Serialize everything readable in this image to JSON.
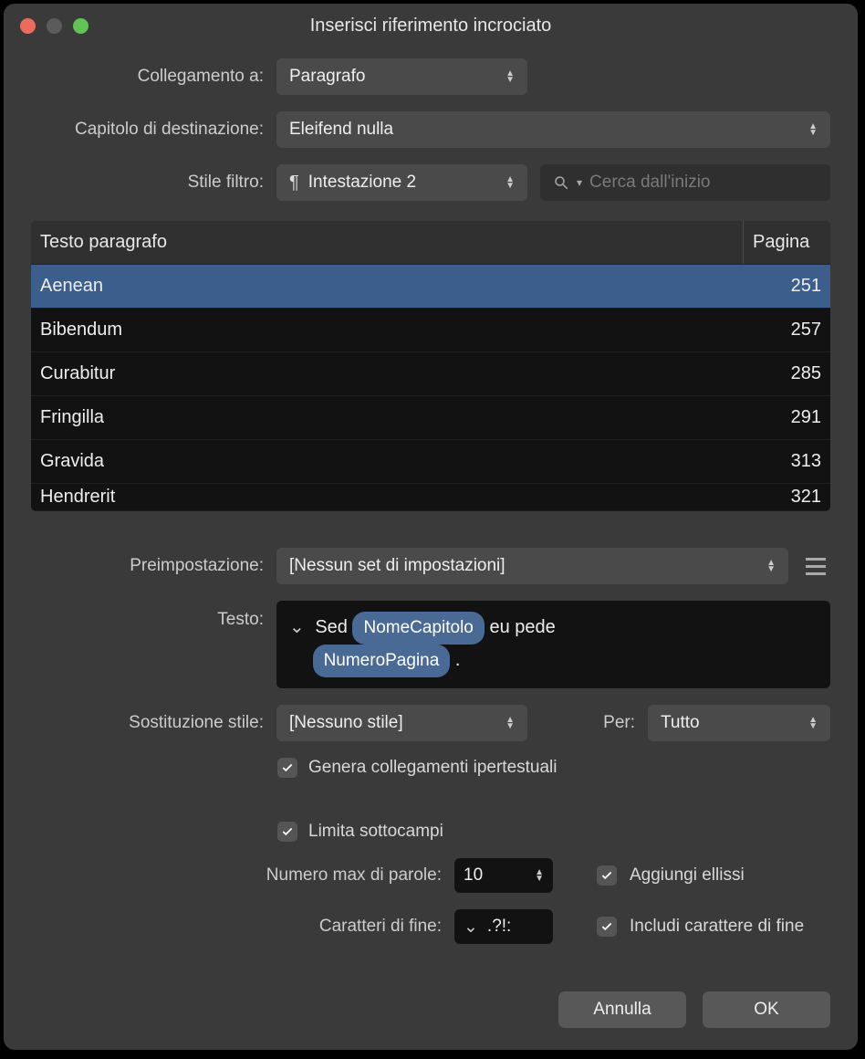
{
  "window": {
    "title": "Inserisci riferimento incrociato"
  },
  "labels": {
    "link_to": "Collegamento a:",
    "dest_chapter": "Capitolo di destinazione:",
    "filter_style": "Stile filtro:",
    "preset": "Preimpostazione:",
    "text": "Testo:",
    "style_sub": "Sostituzione stile:",
    "for": "Per:",
    "max_words": "Numero max di parole:",
    "end_chars": "Caratteri di fine:"
  },
  "dropdowns": {
    "link_to": "Paragrafo",
    "dest_chapter": "Eleifend nulla",
    "filter_style": "Intestazione 2",
    "preset": "[Nessun set di impostazioni]",
    "style_sub": "[Nessuno stile]",
    "for": "Tutto"
  },
  "search": {
    "placeholder": "Cerca dall'inizio"
  },
  "table": {
    "headers": {
      "text": "Testo paragrafo",
      "page": "Pagina"
    },
    "rows": [
      {
        "text": "Aenean",
        "page": "251",
        "selected": true
      },
      {
        "text": "Bibendum",
        "page": "257"
      },
      {
        "text": "Curabitur",
        "page": "285"
      },
      {
        "text": "Fringilla",
        "page": "291"
      },
      {
        "text": "Gravida",
        "page": "313"
      },
      {
        "text": "Hendrerit",
        "page": "321"
      }
    ]
  },
  "text_template": {
    "prefix": "Sed",
    "token1": "NomeCapitolo",
    "mid": "eu pede",
    "token2": "NumeroPagina",
    "suffix": "."
  },
  "checkboxes": {
    "hyperlinks": "Genera collegamenti ipertestuali",
    "limit_sub": "Limita sottocampi",
    "add_ellipsis": "Aggiungi ellissi",
    "include_end": "Includi carattere di fine"
  },
  "values": {
    "max_words": "10",
    "end_chars": ".?!:"
  },
  "buttons": {
    "cancel": "Annulla",
    "ok": "OK"
  }
}
